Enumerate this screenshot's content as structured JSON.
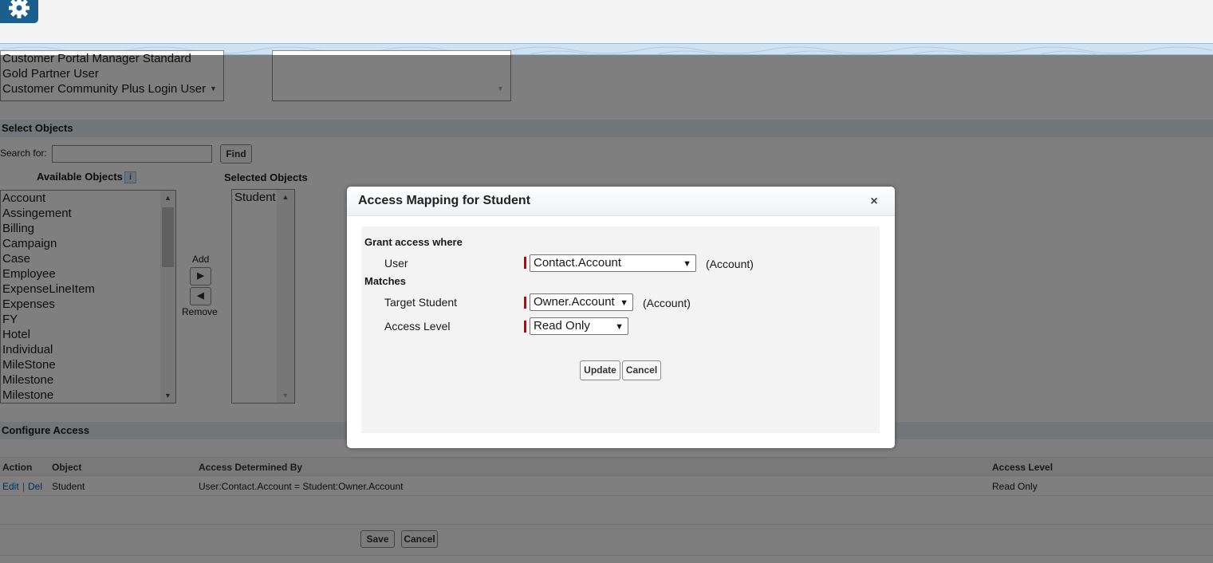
{
  "top": {
    "settings_icon": "gear-icon"
  },
  "profiles": {
    "items": [
      "Customer Portal Manager Standard",
      "Gold Partner User",
      "Customer Community Plus Login User"
    ]
  },
  "select_objects": {
    "section_title": "Select Objects",
    "search_label": "Search  for:",
    "search_value": "",
    "find_label": "Find",
    "available_label": "Available Objects",
    "info_icon": "info-icon",
    "selected_label": "Selected Objects",
    "available_items": [
      "Account",
      "Assingement",
      "Billing",
      "Campaign",
      "Case",
      "Employee",
      "ExpenseLineItem",
      "Expenses",
      "FY",
      "Hotel",
      "Individual",
      "MileStone",
      "Milestone",
      "Milestone"
    ],
    "selected_items": [
      "Student"
    ],
    "add_label": "Add",
    "remove_label": "Remove"
  },
  "configure_access": {
    "section_title": "Configure Access",
    "columns": [
      "Action",
      "Object",
      "Access Determined By",
      "Access Level"
    ],
    "rows": [
      {
        "edit": "Edit",
        "sep": "|",
        "del": "Del",
        "object": "Student",
        "determined_by": "User:Contact.Account = Student:Owner.Account",
        "level": "Read Only"
      }
    ],
    "save_label": "Save",
    "cancel_label": "Cancel"
  },
  "modal": {
    "title": "Access Mapping for Student",
    "close_glyph": "×",
    "grant_heading": "Grant access where",
    "user_label": "User",
    "user_value": "Contact.Account",
    "user_type": "(Account)",
    "matches_heading": "Matches",
    "target_label": "Target Student",
    "target_value": "Owner.Account",
    "target_type": "(Account)",
    "access_label": "Access Level",
    "access_value": "Read Only",
    "update_label": "Update",
    "cancel_label": "Cancel"
  },
  "colors": {
    "brand": "#1b5f8f",
    "required": "#cc0000",
    "link": "#015ba7"
  }
}
